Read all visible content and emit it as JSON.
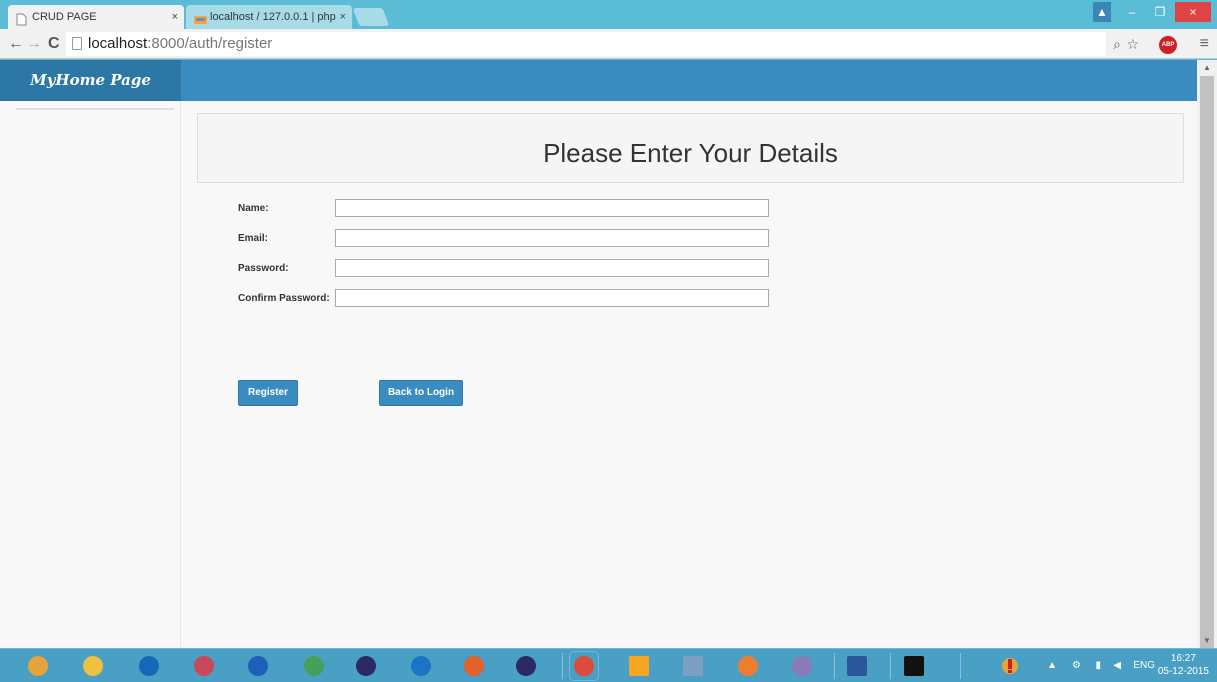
{
  "browser": {
    "tabs": [
      {
        "title": "CRUD PAGE",
        "active": true
      },
      {
        "title": "localhost / 127.0.0.1 | php",
        "active": false
      }
    ],
    "tab_close_glyph": "×",
    "url_host": "localhost",
    "url_rest": ":8000/auth/register"
  },
  "window_controls": {
    "minimize": "–",
    "maximize": "❐",
    "close": "×",
    "user": "▲"
  },
  "toolbar_glyphs": {
    "back": "←",
    "forward": "→",
    "reload": "C",
    "zoom": "⌕",
    "star": "☆",
    "abp": "ABP",
    "menu": "≡"
  },
  "app": {
    "brand": "MyHome Page",
    "heading": "Please Enter Your Details"
  },
  "form": {
    "fields": [
      {
        "label": "Name:",
        "value": ""
      },
      {
        "label": "Email:",
        "value": ""
      },
      {
        "label": "Password:",
        "value": ""
      },
      {
        "label": "Confirm Password:",
        "value": ""
      }
    ],
    "register_label": "Register",
    "back_label": "Back to Login"
  },
  "taskbar": {
    "language": "ENG",
    "time": "16:27",
    "date": "05-12-2015",
    "apps": [
      {
        "name": "chrome-app-icon",
        "color": "#e8a33a"
      },
      {
        "name": "file-explorer-icon",
        "color": "#f0c040"
      },
      {
        "name": "hp-icon",
        "color": "#1468b5"
      },
      {
        "name": "snipping-tool-icon",
        "color": "#c9485b"
      },
      {
        "name": "wireshark-icon",
        "color": "#1f5fb8"
      },
      {
        "name": "media-center-icon",
        "color": "#44a05a"
      },
      {
        "name": "eclipse-icon",
        "color": "#2c2a63"
      },
      {
        "name": "internet-explorer-icon",
        "color": "#1a74c7"
      },
      {
        "name": "firefox-icon",
        "color": "#e2622a"
      },
      {
        "name": "eclipse-2-icon",
        "color": "#2c2a63"
      },
      {
        "name": "google-chrome-icon",
        "color": "#dd4b39"
      },
      {
        "name": "sublime-text-icon",
        "color": "#f5a623"
      },
      {
        "name": "paint-icon",
        "color": "#7d9fc2"
      },
      {
        "name": "xampp-icon",
        "color": "#ef7d2e"
      },
      {
        "name": "php-tool-icon",
        "color": "#8a7ab5"
      },
      {
        "name": "word-icon",
        "color": "#2b579a"
      },
      {
        "name": "cmd-icon",
        "color": "#111111"
      }
    ]
  }
}
